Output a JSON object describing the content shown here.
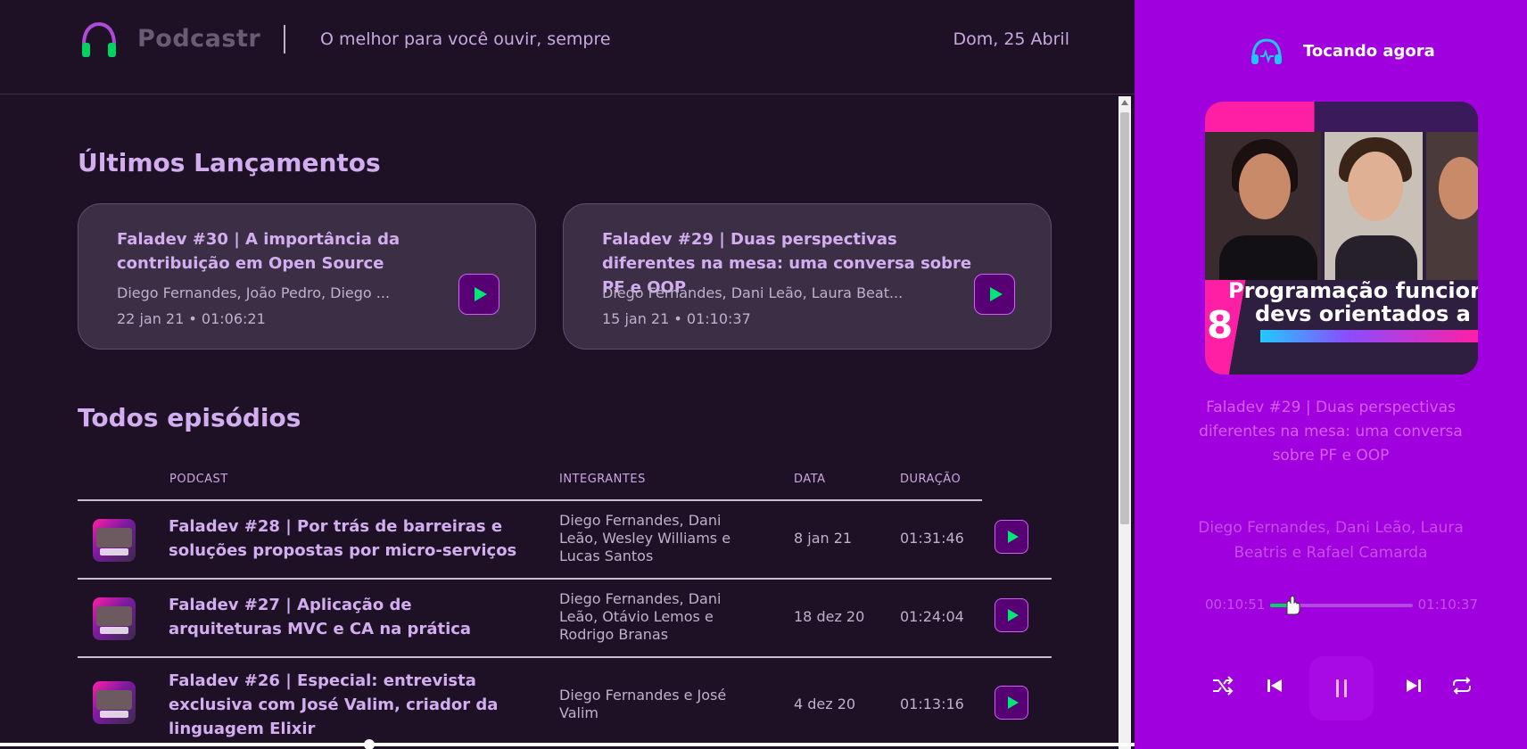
{
  "header": {
    "brand": "Podcastr",
    "tagline": "O melhor para você ouvir, sempre",
    "date": "Dom, 25 Abril"
  },
  "latest": {
    "title": "Últimos Lançamentos",
    "episodes": [
      {
        "title": "Faladev #30 | A importância da contribuição em Open Source",
        "members": "Diego Fernandes, João Pedro, Diego ...",
        "meta": "22 jan 21 • 01:06:21"
      },
      {
        "title": "Faladev #29 | Duas perspectivas diferentes na mesa: uma conversa sobre PF e OOP",
        "members": "Diego Fernandes, Dani Leão, Laura Beat...",
        "meta": "15 jan 21 • 01:10:37"
      }
    ]
  },
  "all": {
    "title": "Todos episódios",
    "columns": [
      "PODCAST",
      "INTEGRANTES",
      "DATA",
      "DURAÇÃO"
    ],
    "rows": [
      {
        "title": "Faladev #28 | Por trás de barreiras e soluções propostas por micro-serviços",
        "members": "Diego Fernandes, Dani Leão, Wesley Williams e Lucas Santos",
        "date": "8 jan 21",
        "duration": "01:31:46"
      },
      {
        "title": "Faladev #27 | Aplicação de arquiteturas MVC e CA na prática",
        "members": "Diego Fernandes, Dani Leão, Otávio Lemos e Rodrigo Branas",
        "date": "18 dez 20",
        "duration": "01:24:04"
      },
      {
        "title": "Faladev #26 | Especial: entrevista exclusiva com José Valim, criador da linguagem Elixir",
        "members": "Diego Fernandes e José Valim",
        "date": "4 dez 20",
        "duration": "01:13:16"
      }
    ]
  },
  "player": {
    "label": "Tocando agora",
    "cover_number": "8",
    "cover_line1": "Programação funcion",
    "cover_line2": "devs orientados a o",
    "title": "Faladev #29 | Duas perspectivas diferentes na mesa: uma conversa sobre PF e OOP",
    "members": "Diego Fernandes, Dani Leão, Laura Beatris e Rafael Camarda",
    "current_time": "00:10:51",
    "total_time": "01:10:37",
    "progress": 0.15
  },
  "colors": {
    "accent": "#a000dd",
    "play": "#04d361",
    "text_title": "#d2aef0",
    "background": "#1e1125"
  }
}
